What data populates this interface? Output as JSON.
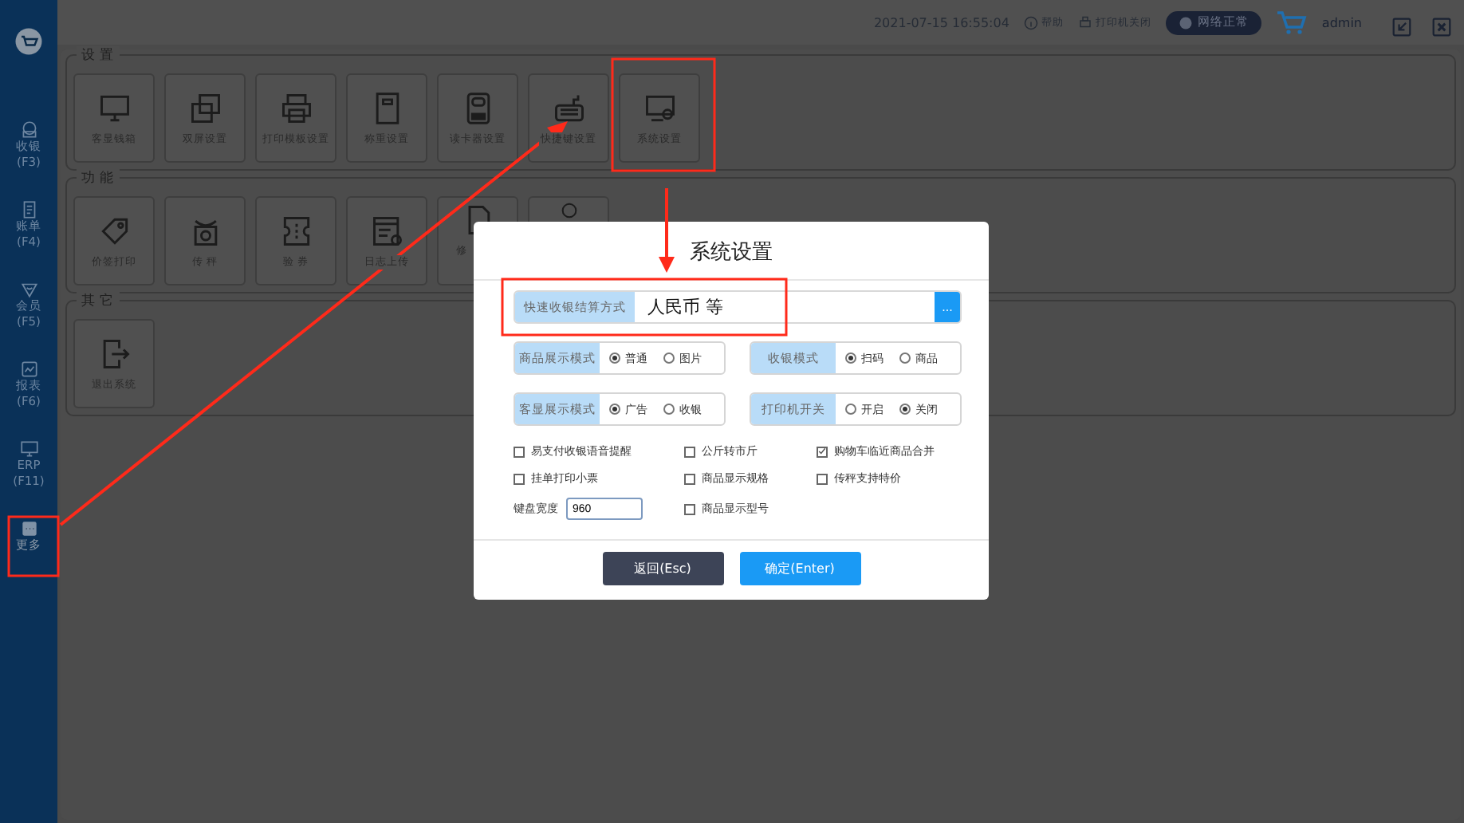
{
  "topbar": {
    "datetime": "2021-07-15 16:55:04",
    "help": "帮助",
    "printer": "打印机关闭",
    "network": "网络正常",
    "user": "admin"
  },
  "sidebar": {
    "items": [
      {
        "label": "收银",
        "shortcut": "(F3)",
        "selected": false
      },
      {
        "label": "账单",
        "shortcut": "(F4)",
        "selected": false
      },
      {
        "label": "会员",
        "shortcut": "(F5)",
        "selected": false
      },
      {
        "label": "报表",
        "shortcut": "(F6)",
        "selected": false
      },
      {
        "label": "ERP",
        "shortcut": "(F11)",
        "selected": false
      },
      {
        "label": "更多",
        "selected": true
      }
    ]
  },
  "sections": [
    {
      "title": "设 置",
      "tiles": [
        {
          "label": "客显钱箱"
        },
        {
          "label": "双屏设置"
        },
        {
          "label": "打印模板设置"
        },
        {
          "label": "称重设置"
        },
        {
          "label": "读卡器设置"
        },
        {
          "label": "快捷键设置"
        },
        {
          "label": "系统设置"
        }
      ]
    },
    {
      "title": "功 能",
      "tiles": [
        {
          "label": "价签打印"
        },
        {
          "label": "传 秤"
        },
        {
          "label": "验 券"
        },
        {
          "label": "日志上传"
        },
        {
          "label": "修",
          "covered": true
        },
        {
          "covered": true
        }
      ]
    },
    {
      "title": "其 它",
      "tiles": [
        {
          "label": "退出系统"
        }
      ]
    }
  ],
  "dialog": {
    "title": "系统设置",
    "settle": {
      "label": "快速收银结算方式",
      "value": "人民币 等",
      "button": "..."
    },
    "radio_groups": [
      {
        "label": "商品展示模式",
        "options": [
          {
            "label": "普通",
            "selected": true
          },
          {
            "label": "图片",
            "selected": false
          }
        ]
      },
      {
        "label": "收银模式",
        "options": [
          {
            "label": "扫码",
            "selected": true
          },
          {
            "label": "商品",
            "selected": false
          }
        ]
      },
      {
        "label": "客显展示模式",
        "options": [
          {
            "label": "广告",
            "selected": true
          },
          {
            "label": "收银",
            "selected": false
          }
        ]
      },
      {
        "label": "打印机开关",
        "options": [
          {
            "label": "开启",
            "selected": false
          },
          {
            "label": "关闭",
            "selected": true
          }
        ]
      }
    ],
    "checkboxes": [
      {
        "label": "易支付收银语音提醒",
        "checked": false
      },
      {
        "label": "公斤转市斤",
        "checked": false
      },
      {
        "label": "购物车临近商品合并",
        "checked": true
      },
      {
        "label": "挂单打印小票",
        "checked": false
      },
      {
        "label": "商品显示规格",
        "checked": false
      },
      {
        "label": "传秤支持特价",
        "checked": false
      },
      {
        "label": "商品显示型号",
        "checked": false
      }
    ],
    "keyboard_width": {
      "label": "键盘宽度",
      "value": "960"
    },
    "buttons": [
      {
        "kind": "secondary",
        "label": "返回(Esc)"
      },
      {
        "kind": "primary",
        "label": "确定(Enter)"
      }
    ]
  }
}
